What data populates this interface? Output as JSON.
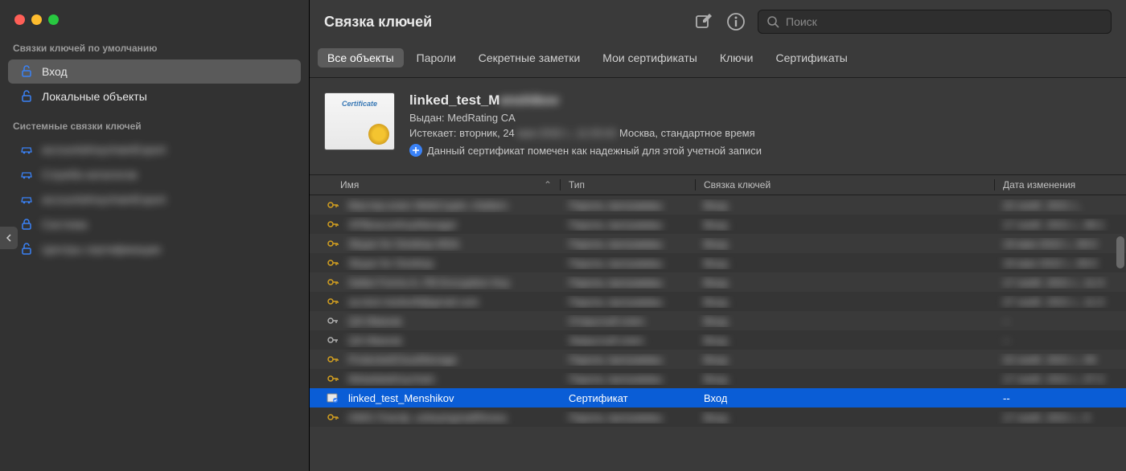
{
  "sidebar": {
    "section1_title": "Связки ключей по умолчанию",
    "section2_title": "Системные связки ключей",
    "items_default": [
      {
        "label": "Вход",
        "icon": "lock-open",
        "selected": true
      },
      {
        "label": "Локальные объекты",
        "icon": "lock-open",
        "selected": false
      }
    ],
    "items_system": [
      {
        "label": "accountsKeychainExport",
        "icon": "car",
        "blurred": true
      },
      {
        "label": "Служба каталогов",
        "icon": "car",
        "blurred": true
      },
      {
        "label": "accountsKeychainExport",
        "icon": "car",
        "blurred": true
      },
      {
        "label": "Система",
        "icon": "lock",
        "blurred": true
      },
      {
        "label": "Центры сертификации",
        "icon": "lock-open",
        "blurred": true
      }
    ]
  },
  "header": {
    "title": "Связка ключей",
    "search_placeholder": "Поиск"
  },
  "tabs": [
    {
      "label": "Все объекты",
      "active": true
    },
    {
      "label": "Пароли",
      "active": false
    },
    {
      "label": "Секретные заметки",
      "active": false
    },
    {
      "label": "Мои сертификаты",
      "active": false
    },
    {
      "label": "Ключи",
      "active": false
    },
    {
      "label": "Сертификаты",
      "active": false
    }
  ],
  "cert_detail": {
    "name_prefix": "linked_test_M",
    "name_blur": "enshikov",
    "issued_prefix": "Выдан:",
    "issued_value": "MedRating CA",
    "expires_prefix": "Истекает:",
    "expires_value_clear": "вторник, 24",
    "expires_value_blur": "мая 2032 г., 11:03:42",
    "expires_value_tail": "Москва, стандартное время",
    "trust_text": "Данный сертификат помечен как надежный для этой учетной записи"
  },
  "columns": {
    "name": "Имя",
    "type": "Тип",
    "keychain": "Связка ключей",
    "modified": "Дата изменения"
  },
  "rows": [
    {
      "name": "Мастер-ключ WebCrypto «Safari»",
      "type": "Пароль программы",
      "kc": "Вход",
      "date": "22 нояб. 2021 г., ",
      "icon": "key",
      "blurred": true
    },
    {
      "name": "XPBeaconKeyManager",
      "type": "Пароль программы",
      "kc": "Вход",
      "date": "17 нояб. 2021 г., 08:1",
      "icon": "key",
      "blurred": true
    },
    {
      "name": "Skype for Desktop MSA",
      "type": "Пароль программы",
      "kc": "Вход",
      "date": "19 мая 2022 г., 09:0",
      "icon": "key",
      "blurred": true
    },
    {
      "name": "Skype for Desktop",
      "type": "Пароль программы",
      "kc": "Вход",
      "date": "19 мая 2022 г., 09:0",
      "icon": "key",
      "blurred": true
    },
    {
      "name": "Safari Forms A..FB Encryption Key",
      "type": "Пароль программы",
      "kc": "Вход",
      "date": "17 нояб. 2021 г., 11:3",
      "icon": "key",
      "blurred": true
    },
    {
      "name": "sa-test-medsoft@gmail.com",
      "type": "Пароль программы",
      "kc": "Вход",
      "date": "27 нояб. 2021 г., 11:3",
      "icon": "key",
      "blurred": true
    },
    {
      "name": "QA Иванов",
      "type": "Открытый ключ",
      "kc": "Вход",
      "date": "--",
      "icon": "pubkey",
      "blurred": true
    },
    {
      "name": "QA Иванов",
      "type": "Закрытый ключ",
      "kc": "Вход",
      "date": "--",
      "icon": "privkey",
      "blurred": true
    },
    {
      "name": "ProtectedCloudStorage",
      "type": "Пароль программы",
      "kc": "Вход",
      "date": "22 нояб. 2021 г., 09",
      "icon": "key",
      "blurred": true
    },
    {
      "name": "MetadataKeychain",
      "type": "Пароль программы",
      "kc": "Вход",
      "date": "17 нояб. 2021 г., 07:2",
      "icon": "key",
      "blurred": true
    },
    {
      "name": "linked_test_Menshikov",
      "type": "Сертификат",
      "kc": "Вход",
      "date": "--",
      "icon": "cert",
      "blurred": false,
      "selected": true
    },
    {
      "name": "HWG Платф. unkeying/saltResea",
      "type": "Пароль программы",
      "kc": "Вход",
      "date": "17 нояб. 2021 г., 5",
      "icon": "key",
      "blurred": true
    }
  ]
}
